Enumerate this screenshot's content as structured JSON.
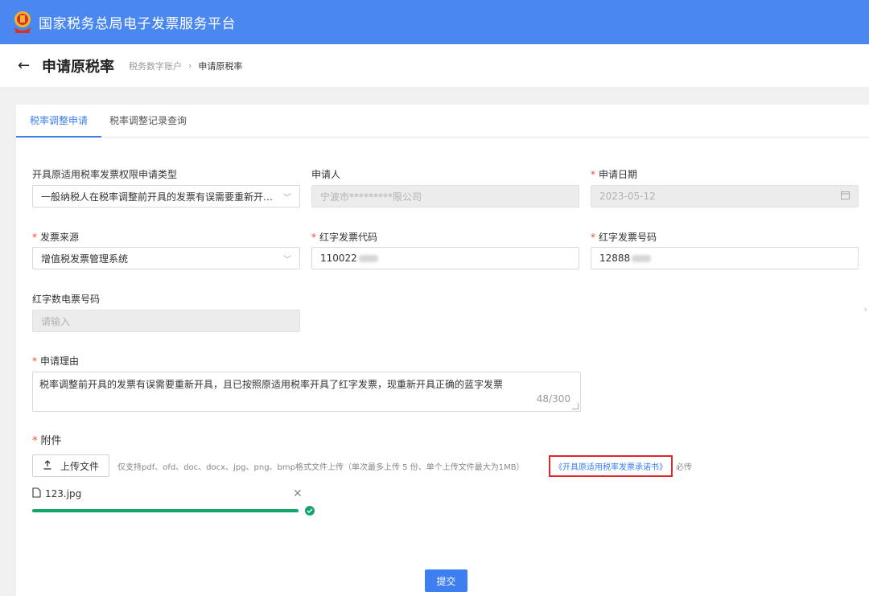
{
  "header": {
    "platform_title": "国家税务总局电子发票服务平台"
  },
  "subheader": {
    "title": "申请原税率",
    "breadcrumb": [
      "税务数字账户",
      "申请原税率"
    ],
    "breadcrumb_separator": "›"
  },
  "tabs": [
    {
      "label": "税率调整申请",
      "active": true
    },
    {
      "label": "税率调整记录查询",
      "active": false
    }
  ],
  "form": {
    "permission_type": {
      "label": "开具原适用税率发票权限申请类型",
      "value": "一般纳税人在税率调整前开具的发票有误需要重新开具，且已按照原适用税率开具了红字发票"
    },
    "applicant": {
      "label": "申请人",
      "value": "宁波市*********限公司"
    },
    "apply_date": {
      "label": "申请日期",
      "value": "2023-05-12"
    },
    "invoice_source": {
      "label": "发票来源",
      "value": "增值税发票管理系统"
    },
    "red_invoice_code": {
      "label": "红字发票代码",
      "value": "110022"
    },
    "red_invoice_number": {
      "label": "红字发票号码",
      "value": "12888"
    },
    "red_digital_invoice_number": {
      "label": "红字数电票号码",
      "placeholder": "请输入"
    },
    "reason": {
      "label": "申请理由",
      "value": "税率调整前开具的发票有误需要重新开具，且已按照原适用税率开具了红字发票，现重新开具正确的蓝字发票",
      "counter": "48/300"
    },
    "attachment": {
      "label": "附件",
      "upload_label": "上传文件",
      "hint": "仅支持pdf、ofd、doc、docx、jpg、png、bmp格式文件上传（单次最多上传 5 份、单个上传文件最大为1MB）",
      "pledge_link": "《开具原适用税率发票承诺书》",
      "required_note": "必传",
      "file": {
        "name": "123.jpg",
        "progress": 1.0
      }
    },
    "submit_label": "提交"
  },
  "colors": {
    "topbar": "#4a87ef",
    "accent": "#3d7ef0",
    "required": "#f5473b",
    "success": "#10a66b",
    "highlight_box": "#e3262b"
  }
}
